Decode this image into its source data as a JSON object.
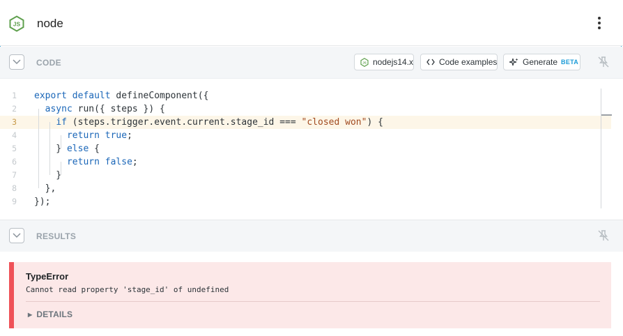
{
  "header": {
    "title": "node",
    "logo_icon": "nodejs-icon",
    "menu_icon": "kebab-menu-icon"
  },
  "code_section": {
    "label": "CODE",
    "runtime_label": "nodejs14.x",
    "examples_label": "Code examples",
    "generate_label": "Generate",
    "beta_label": "BETA",
    "pin_icon": "pin-off-icon",
    "active_line": 3,
    "lines": [
      {
        "n": "1",
        "parts": [
          {
            "t": "export default",
            "c": "kw"
          },
          {
            "t": " defineComponent({",
            "c": ""
          }
        ]
      },
      {
        "n": "2",
        "parts": [
          {
            "t": "  ",
            "c": ""
          },
          {
            "t": "async",
            "c": "kw"
          },
          {
            "t": " run({ steps }) {",
            "c": ""
          }
        ]
      },
      {
        "n": "3",
        "parts": [
          {
            "t": "    ",
            "c": ""
          },
          {
            "t": "if",
            "c": "kw"
          },
          {
            "t": " (steps.trigger.event.current.stage_id === ",
            "c": ""
          },
          {
            "t": "\"closed won\"",
            "c": "str"
          },
          {
            "t": ") {",
            "c": ""
          }
        ]
      },
      {
        "n": "4",
        "parts": [
          {
            "t": "      ",
            "c": ""
          },
          {
            "t": "return",
            "c": "kw"
          },
          {
            "t": " ",
            "c": ""
          },
          {
            "t": "true",
            "c": "kw"
          },
          {
            "t": ";",
            "c": ""
          }
        ]
      },
      {
        "n": "5",
        "parts": [
          {
            "t": "    } ",
            "c": ""
          },
          {
            "t": "else",
            "c": "kw"
          },
          {
            "t": " {",
            "c": ""
          }
        ]
      },
      {
        "n": "6",
        "parts": [
          {
            "t": "      ",
            "c": ""
          },
          {
            "t": "return",
            "c": "kw"
          },
          {
            "t": " ",
            "c": ""
          },
          {
            "t": "false",
            "c": "kw"
          },
          {
            "t": ";",
            "c": ""
          }
        ]
      },
      {
        "n": "7",
        "parts": [
          {
            "t": "    }",
            "c": ""
          }
        ]
      },
      {
        "n": "8",
        "parts": [
          {
            "t": "  },",
            "c": ""
          }
        ]
      },
      {
        "n": "9",
        "parts": [
          {
            "t": "});",
            "c": ""
          }
        ]
      }
    ]
  },
  "results_section": {
    "label": "RESULTS",
    "pin_icon": "pin-off-icon",
    "error": {
      "title": "TypeError",
      "message": "Cannot read property 'stage_id' of undefined",
      "details_label": "DETAILS"
    }
  },
  "colors": {
    "accent": "#1b9bd7",
    "keyword": "#1a66b8",
    "string": "#a14a1f",
    "error_bg": "#fce8e8",
    "error_border": "#ef5258",
    "node_green": "#5fa04e"
  }
}
